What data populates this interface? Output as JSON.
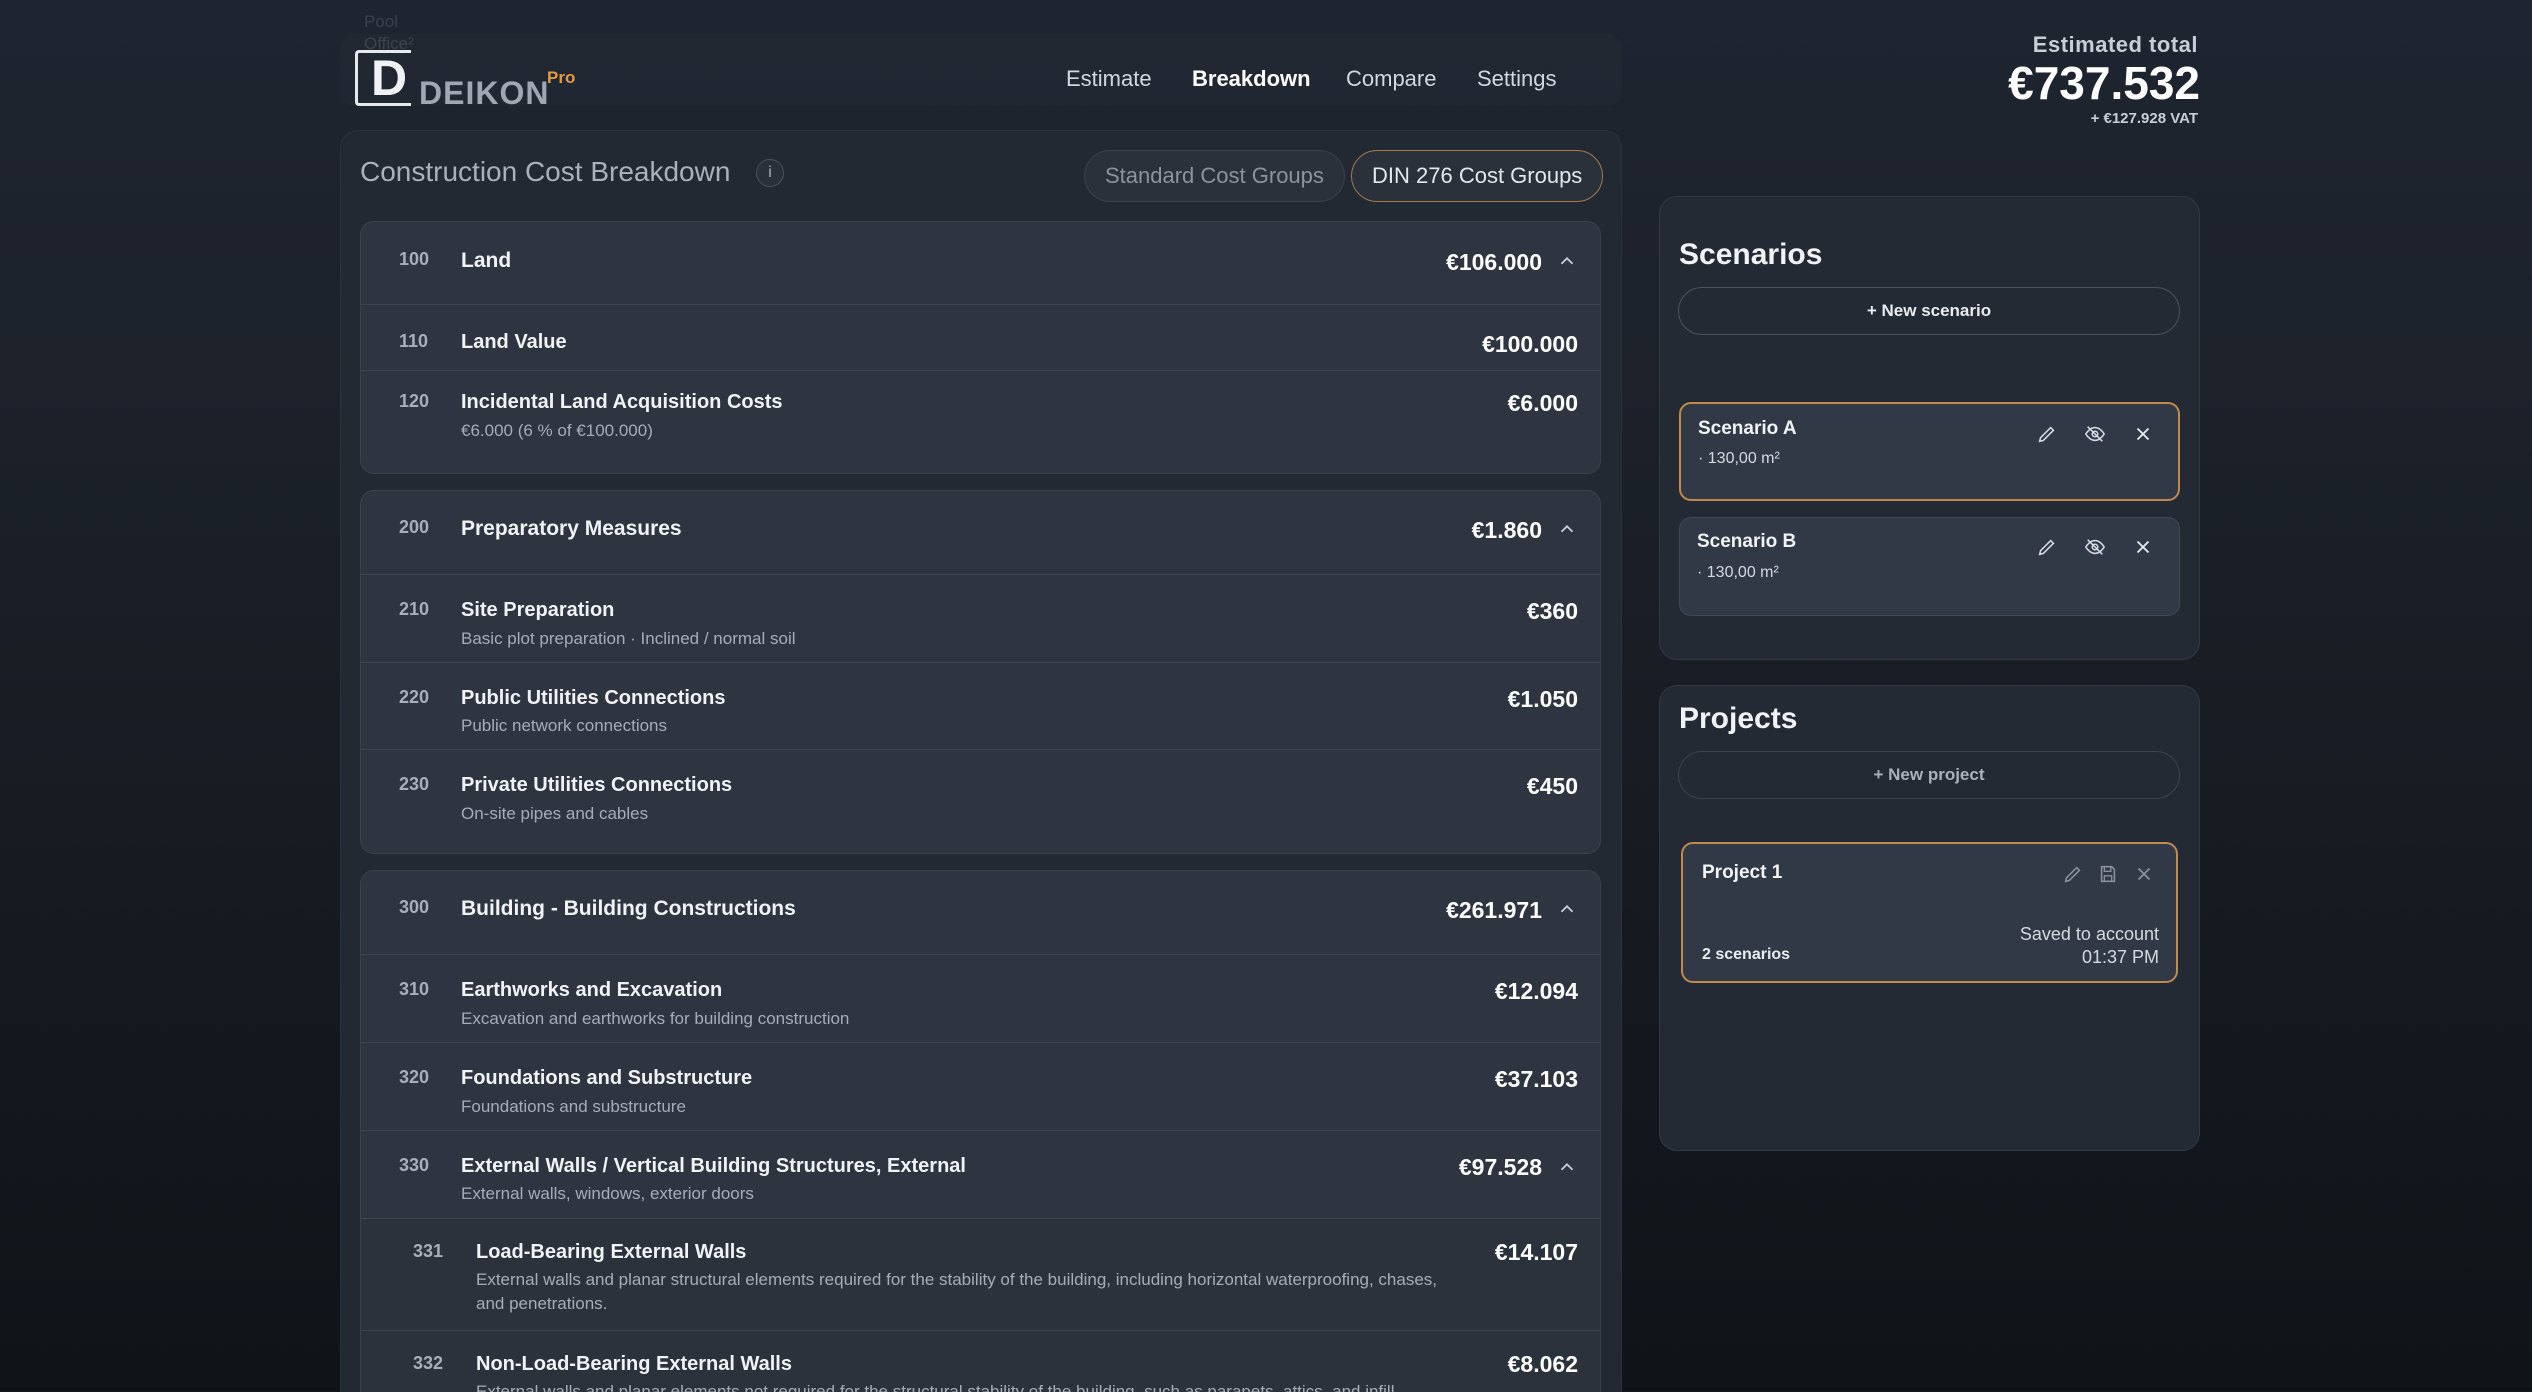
{
  "ghost_text": [
    "Pool",
    "Office²"
  ],
  "brand": {
    "name": "DEIKON",
    "badge": "Pro"
  },
  "nav": {
    "items": [
      "Estimate",
      "Breakdown",
      "Compare",
      "Settings"
    ],
    "active": "Breakdown"
  },
  "estimate": {
    "label": "Estimated total",
    "value": "€737.532",
    "vat": "+ €127.928 VAT"
  },
  "breakdown": {
    "title": "Construction Cost Breakdown",
    "info": "i",
    "toggle_standard": "Standard Cost Groups",
    "toggle_din": "DIN 276 Cost Groups",
    "groups": [
      {
        "code": "100",
        "title": "Land",
        "amount": "€106.000",
        "rows": [
          {
            "code": "110",
            "title": "Land Value",
            "sub": "",
            "amount": "€100.000"
          },
          {
            "code": "120",
            "title": "Incidental Land Acquisition Costs",
            "sub": "€6.000 (6 % of €100.000)",
            "amount": "€6.000"
          }
        ]
      },
      {
        "code": "200",
        "title": "Preparatory Measures",
        "amount": "€1.860",
        "rows": [
          {
            "code": "210",
            "title": "Site Preparation",
            "sub": "Basic plot preparation · Inclined / normal soil",
            "amount": "€360"
          },
          {
            "code": "220",
            "title": "Public Utilities Connections",
            "sub": "Public network connections",
            "amount": "€1.050"
          },
          {
            "code": "230",
            "title": "Private Utilities Connections",
            "sub": "On-site pipes and cables",
            "amount": "€450"
          }
        ]
      },
      {
        "code": "300",
        "title": "Building - Building Constructions",
        "amount": "€261.971",
        "rows": [
          {
            "code": "310",
            "title": "Earthworks and Excavation",
            "sub": "Excavation and earthworks for building construction",
            "amount": "€12.094"
          },
          {
            "code": "320",
            "title": "Foundations and Substructure",
            "sub": "Foundations and substructure",
            "amount": "€37.103"
          },
          {
            "code": "330",
            "title": "External Walls / Vertical Building Structures, External",
            "sub": "External walls, windows, exterior doors",
            "amount": "€97.528"
          },
          {
            "code": "331",
            "title": "Load-Bearing External Walls",
            "sub1": "External walls and planar structural elements required for the stability of the building, including horizontal waterproofing, chases,",
            "sub2": "and penetrations.",
            "amount": "€14.107"
          },
          {
            "code": "332",
            "title": "Non-Load-Bearing External Walls",
            "sub": "External walls and planar elements not required for the structural stability of the building, such as parapets, attics, and infill",
            "amount": "€8.062"
          }
        ]
      }
    ]
  },
  "scenarios": {
    "title": "Scenarios",
    "new_label": "+ New scenario",
    "items": [
      {
        "name": "Scenario A",
        "area": "· 130,00 m²",
        "selected": true
      },
      {
        "name": "Scenario B",
        "area": "· 130,00 m²",
        "selected": false
      }
    ]
  },
  "projects": {
    "title": "Projects",
    "new_label": "+ New project",
    "items": [
      {
        "name": "Project 1",
        "count": "2 scenarios",
        "saved": "Saved to account",
        "time": "01:37 PM"
      }
    ]
  },
  "colors": {
    "accent": "#c0894d",
    "brand_badge": "#e39a45",
    "background": "#1c2129",
    "panel": "#232933"
  }
}
